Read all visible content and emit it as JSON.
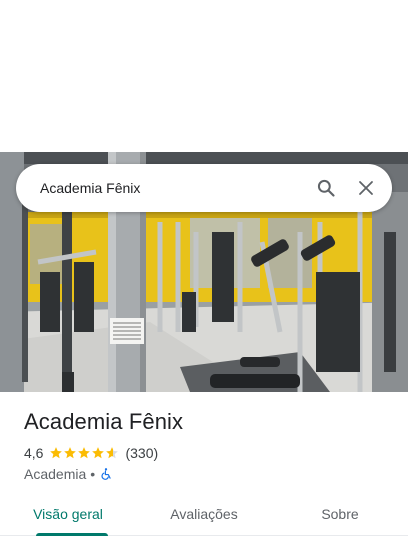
{
  "search": {
    "query": "Academia Fênix",
    "search_icon": "search-icon",
    "close_icon": "close-icon"
  },
  "place": {
    "name": "Academia Fênix",
    "rating": "4,6",
    "rating_value": 4.6,
    "review_count": "(330)",
    "category": "Academia",
    "separator": "•",
    "accessibility_icon": "wheelchair-icon"
  },
  "photo_notice": {
    "lines": [
      "CASO SE SINTA",
      "DESCONFORTÁVEL",
      "E ENJOADO",
      "PEDIMOS QUE",
      "AVISE"
    ]
  },
  "tabs": [
    {
      "label": "Visão geral",
      "active": true
    },
    {
      "label": "Avaliações",
      "active": false
    },
    {
      "label": "Sobre",
      "active": false
    }
  ],
  "colors": {
    "accent": "#00796b",
    "star": "#fbbc04",
    "wall_yellow": "#e8c21a",
    "accessibility_blue": "#1a73e8"
  }
}
